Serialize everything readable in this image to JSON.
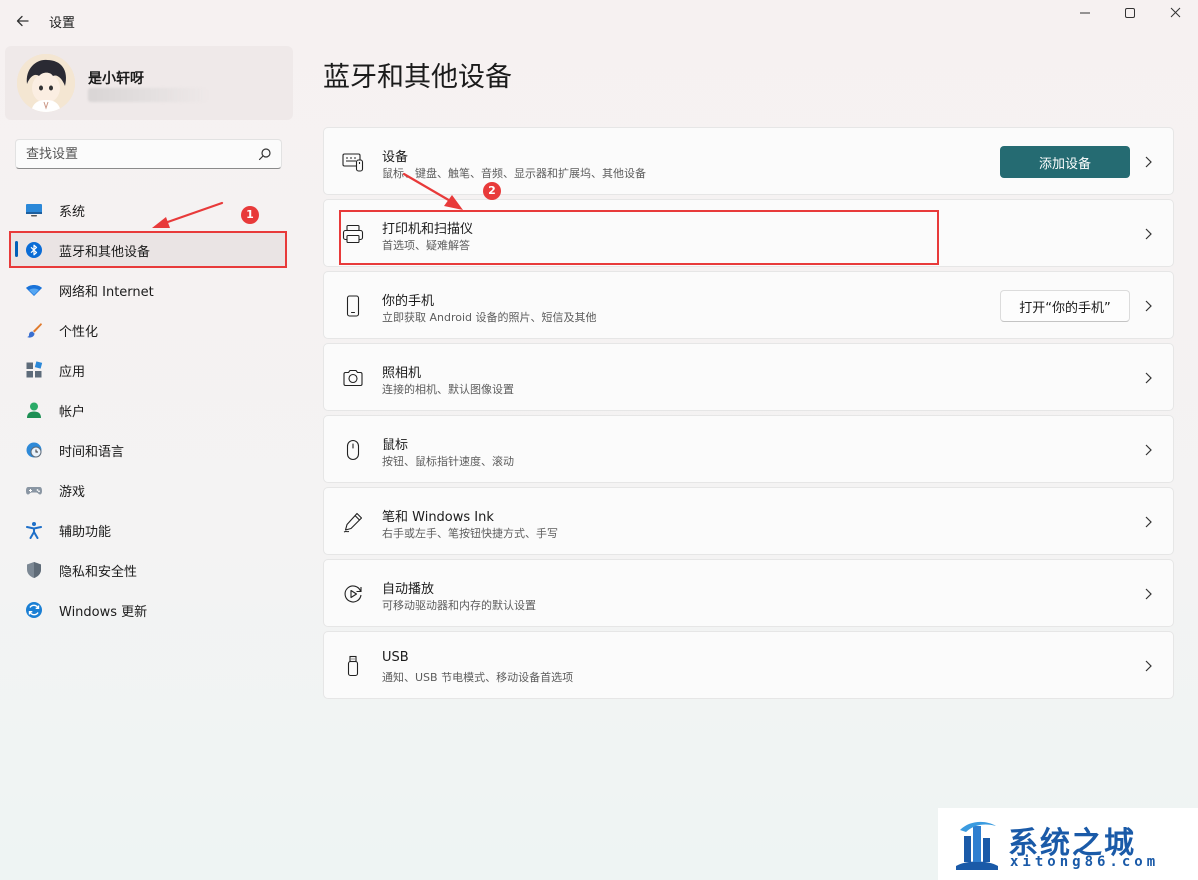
{
  "window": {
    "title": "设置"
  },
  "profile": {
    "name": "是小轩呀"
  },
  "search": {
    "placeholder": "查找设置"
  },
  "nav": {
    "items": [
      {
        "label": "系统",
        "icon": "monitor-icon",
        "active": false
      },
      {
        "label": "蓝牙和其他设备",
        "icon": "bluetooth-icon",
        "active": true
      },
      {
        "label": "网络和 Internet",
        "icon": "wifi-icon",
        "active": false
      },
      {
        "label": "个性化",
        "icon": "brush-icon",
        "active": false
      },
      {
        "label": "应用",
        "icon": "apps-icon",
        "active": false
      },
      {
        "label": "帐户",
        "icon": "account-icon",
        "active": false
      },
      {
        "label": "时间和语言",
        "icon": "clock-globe-icon",
        "active": false
      },
      {
        "label": "游戏",
        "icon": "gamepad-icon",
        "active": false
      },
      {
        "label": "辅助功能",
        "icon": "accessibility-icon",
        "active": false
      },
      {
        "label": "隐私和安全性",
        "icon": "shield-icon",
        "active": false
      },
      {
        "label": "Windows 更新",
        "icon": "update-icon",
        "active": false
      }
    ]
  },
  "page": {
    "title": "蓝牙和其他设备"
  },
  "cards": [
    {
      "title": "设备",
      "subtitle": "鼠标、键盘、触笔、音频、显示器和扩展坞、其他设备",
      "icon": "devices-icon",
      "button": "添加设备"
    },
    {
      "title": "打印机和扫描仪",
      "subtitle": "首选项、疑难解答",
      "icon": "printer-icon"
    },
    {
      "title": "你的手机",
      "subtitle": "立即获取 Android 设备的照片、短信及其他",
      "icon": "phone-icon",
      "button": "打开“你的手机”"
    },
    {
      "title": "照相机",
      "subtitle": "连接的相机、默认图像设置",
      "icon": "camera-icon"
    },
    {
      "title": "鼠标",
      "subtitle": "按钮、鼠标指针速度、滚动",
      "icon": "mouse-icon"
    },
    {
      "title": "笔和 Windows Ink",
      "subtitle": "右手或左手、笔按钮快捷方式、手写",
      "icon": "pen-icon"
    },
    {
      "title": "自动播放",
      "subtitle": "可移动驱动器和内存的默认设置",
      "icon": "autoplay-icon"
    },
    {
      "title": "USB",
      "subtitle": "通知、USB 节电模式、移动设备首选项",
      "icon": "usb-icon"
    }
  ],
  "annotations": {
    "badge1": "1",
    "badge2": "2",
    "color": "#e83a3a"
  },
  "watermark": {
    "text": "系统之城",
    "domain": "xitong86.com",
    "color": "#1a5aa8"
  },
  "colors": {
    "accent": "#005fb8",
    "primary_button": "#256b72"
  }
}
